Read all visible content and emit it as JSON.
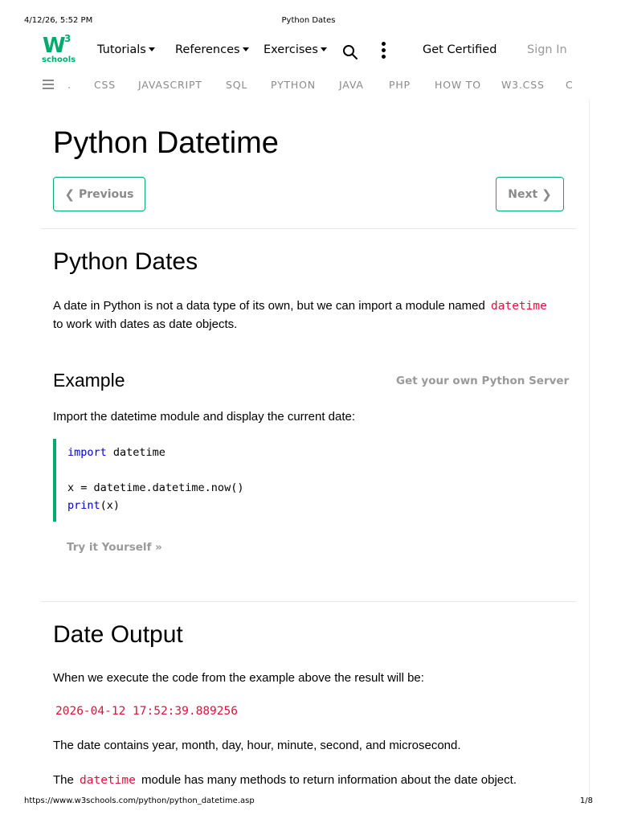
{
  "print_header": {
    "datetime": "4/12/26, 5:52 PM",
    "title": "Python Dates"
  },
  "topnav": {
    "logo_main": "W",
    "logo_sup": "3",
    "logo_sub": "schools",
    "tutorials": "Tutorials",
    "references": "References",
    "exercises": "Exercises",
    "get_certified": "Get Certified",
    "sign_in": "Sign In"
  },
  "subnav": {
    "items": [
      ".",
      "CSS",
      "JAVASCRIPT",
      "SQL",
      "PYTHON",
      "JAVA",
      "PHP",
      "HOW TO",
      "W3.CSS",
      "C"
    ]
  },
  "main": {
    "page_title": "Python Datetime",
    "prev_label": "Previous",
    "next_label": "Next",
    "section1": {
      "heading": "Python Dates",
      "intro_part1": "A date in Python is not a data type of its own, but we can import a module named",
      "intro_code": "datetime",
      "intro_part2": "to work with dates as date objects."
    },
    "example": {
      "heading": "Example",
      "server_link": "Get your own Python Server",
      "description": "Import the datetime module and display the current date:",
      "code": {
        "line1_kw": "import",
        "line1_rest": " datetime",
        "line2": "x = datetime.datetime.now()",
        "line3_kw": "print",
        "line3_rest": "(x)"
      },
      "try_it": "Try it Yourself »"
    },
    "section2": {
      "heading": "Date Output",
      "p1": "When we execute the code from the example above the result will be:",
      "output": "2026-04-12 17:52:39.889256",
      "p2": "The date contains year, month, day, hour, minute, second, and microsecond.",
      "p3_part1": "The",
      "p3_code": "datetime",
      "p3_part2": "module has many methods to return information about the date object."
    }
  },
  "print_footer": {
    "url": "https://www.w3schools.com/python/python_datetime.asp",
    "page": "1/8"
  },
  "colors": {
    "brand_green": "#04AA6D",
    "code_red": "#dc143c",
    "keyword_blue": "#0000cd"
  }
}
